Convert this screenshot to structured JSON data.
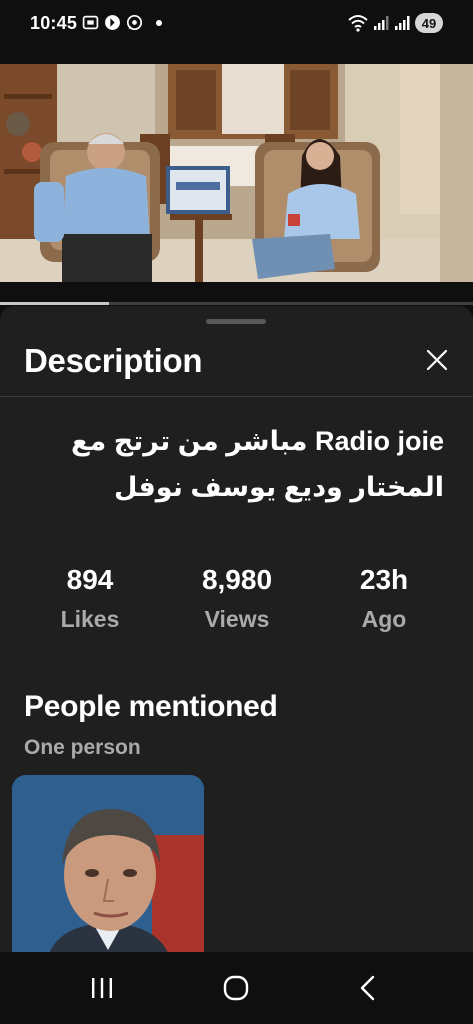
{
  "status_bar": {
    "time": "10:45",
    "battery": "49",
    "icons": [
      "screenshot-icon",
      "app-icon",
      "whatsapp-icon",
      "notification-dot",
      "wifi-icon",
      "signal-icon",
      "signal-icon",
      "battery-icon"
    ]
  },
  "video": {
    "thumbnail": "interview-scene",
    "progress": 0.23
  },
  "description_sheet": {
    "title": "Description",
    "close_icon": "close-icon",
    "video_title_line1": "Radio joie مباشر من ترتج مع",
    "video_title_line2": "المختار وديع يوسف نوفل",
    "stats": [
      {
        "value": "894",
        "label": "Likes"
      },
      {
        "value": "8,980",
        "label": "Views"
      },
      {
        "value": "23h",
        "label": "Ago"
      }
    ],
    "people": {
      "heading": "People mentioned",
      "subheading": "One person",
      "avatar": "person-portrait"
    }
  },
  "nav_bar": {
    "buttons": [
      "recents-icon",
      "home-icon",
      "back-icon"
    ]
  }
}
